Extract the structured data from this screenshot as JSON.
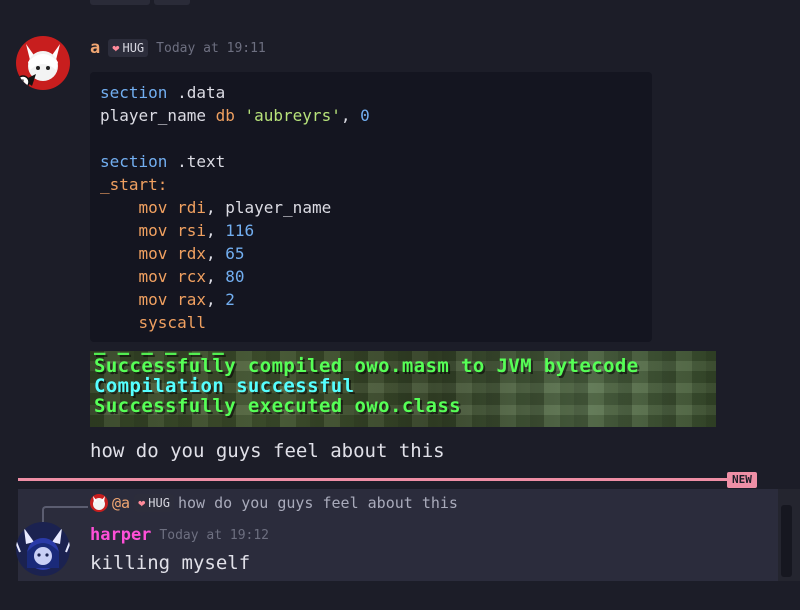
{
  "message1": {
    "author": "a",
    "author_color": "#f0a672",
    "tag_label": "HUG",
    "timestamp": "Today at 19:11",
    "code_lines": [
      [
        {
          "t": "section",
          "c": "kw"
        },
        {
          "t": " .data",
          "c": "ident"
        }
      ],
      [
        {
          "t": "player_name ",
          "c": "ident"
        },
        {
          "t": "db",
          "c": "op"
        },
        {
          "t": " ",
          "c": "ident"
        },
        {
          "t": "'aubreyrs'",
          "c": "str"
        },
        {
          "t": ", ",
          "c": "ident"
        },
        {
          "t": "0",
          "c": "num"
        }
      ],
      [],
      [
        {
          "t": "section",
          "c": "kw"
        },
        {
          "t": " .text",
          "c": "ident"
        }
      ],
      [
        {
          "t": "_start:",
          "c": "op"
        }
      ],
      [
        {
          "t": "    ",
          "c": "ident"
        },
        {
          "t": "mov",
          "c": "op"
        },
        {
          "t": " ",
          "c": "ident"
        },
        {
          "t": "rdi",
          "c": "op"
        },
        {
          "t": ", player_name",
          "c": "ident"
        }
      ],
      [
        {
          "t": "    ",
          "c": "ident"
        },
        {
          "t": "mov",
          "c": "op"
        },
        {
          "t": " ",
          "c": "ident"
        },
        {
          "t": "rsi",
          "c": "op"
        },
        {
          "t": ", ",
          "c": "ident"
        },
        {
          "t": "116",
          "c": "num"
        }
      ],
      [
        {
          "t": "    ",
          "c": "ident"
        },
        {
          "t": "mov",
          "c": "op"
        },
        {
          "t": " ",
          "c": "ident"
        },
        {
          "t": "rdx",
          "c": "op"
        },
        {
          "t": ", ",
          "c": "ident"
        },
        {
          "t": "65",
          "c": "num"
        }
      ],
      [
        {
          "t": "    ",
          "c": "ident"
        },
        {
          "t": "mov",
          "c": "op"
        },
        {
          "t": " ",
          "c": "ident"
        },
        {
          "t": "rcx",
          "c": "op"
        },
        {
          "t": ", ",
          "c": "ident"
        },
        {
          "t": "80",
          "c": "num"
        }
      ],
      [
        {
          "t": "    ",
          "c": "ident"
        },
        {
          "t": "mov",
          "c": "op"
        },
        {
          "t": " ",
          "c": "ident"
        },
        {
          "t": "rax",
          "c": "op"
        },
        {
          "t": ", ",
          "c": "ident"
        },
        {
          "t": "2",
          "c": "num"
        }
      ],
      [
        {
          "t": "    ",
          "c": "ident"
        },
        {
          "t": "syscall",
          "c": "op"
        }
      ]
    ],
    "image_lines": {
      "line1": "Successfully compiled owo.masm to JVM bytecode",
      "line2": "Compilation successful",
      "line3": "Successfully executed owo.class"
    },
    "text": "how do you guys feel about this"
  },
  "divider": {
    "badge": "NEW"
  },
  "message2": {
    "reply_mention": "@a",
    "reply_tag_label": "HUG",
    "reply_preview": "how do you guys feel about this",
    "author": "harper",
    "author_color": "#ff4fd8",
    "timestamp": "Today at 19:12",
    "text": "killing myself"
  }
}
